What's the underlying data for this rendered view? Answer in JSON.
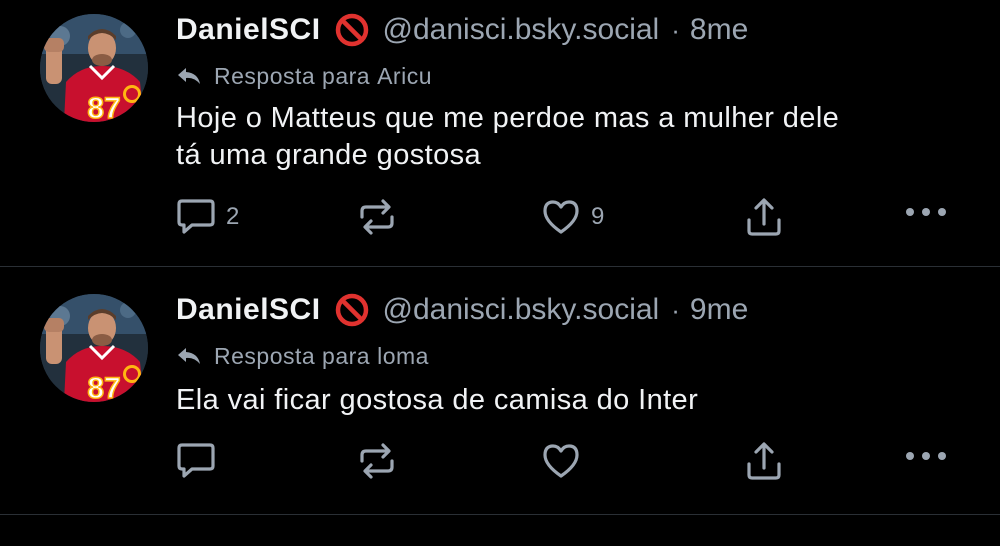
{
  "colors": {
    "background": "#000000",
    "text_primary": "#f1f3f5",
    "text_secondary": "#9ca6b2",
    "divider": "#2a2f35",
    "badge_red": "#e0322f",
    "avatar_jersey_red": "#c8102e",
    "avatar_jersey_gold": "#ffb612"
  },
  "posts": [
    {
      "author": {
        "display_name": "DanielSCI",
        "badge_icon": "prohibited-icon",
        "handle": "@danisci.bsky.social"
      },
      "separator": "·",
      "timestamp": "8me",
      "reply_to": {
        "prefix": "Resposta para",
        "target": "Aricu"
      },
      "text_lines": [
        "Hoje o Matteus que me perdoe mas a mulher dele",
        "tá uma grande gostosa"
      ],
      "actions": {
        "reply": {
          "icon": "speech-bubble-icon",
          "count": "2"
        },
        "repost": {
          "icon": "repost-arrows-icon",
          "count": ""
        },
        "like": {
          "icon": "heart-icon",
          "count": "9"
        },
        "share": {
          "icon": "share-upload-icon"
        },
        "more": {
          "icon": "ellipsis-icon"
        }
      }
    },
    {
      "author": {
        "display_name": "DanielSCI",
        "badge_icon": "prohibited-icon",
        "handle": "@danisci.bsky.social"
      },
      "separator": "·",
      "timestamp": "9me",
      "reply_to": {
        "prefix": "Resposta para",
        "target": "loma"
      },
      "text_lines": [
        "Ela vai ficar gostosa de camisa do Inter"
      ],
      "actions": {
        "reply": {
          "icon": "speech-bubble-icon",
          "count": ""
        },
        "repost": {
          "icon": "repost-arrows-icon",
          "count": ""
        },
        "like": {
          "icon": "heart-icon",
          "count": ""
        },
        "share": {
          "icon": "share-upload-icon"
        },
        "more": {
          "icon": "ellipsis-icon"
        }
      }
    }
  ]
}
